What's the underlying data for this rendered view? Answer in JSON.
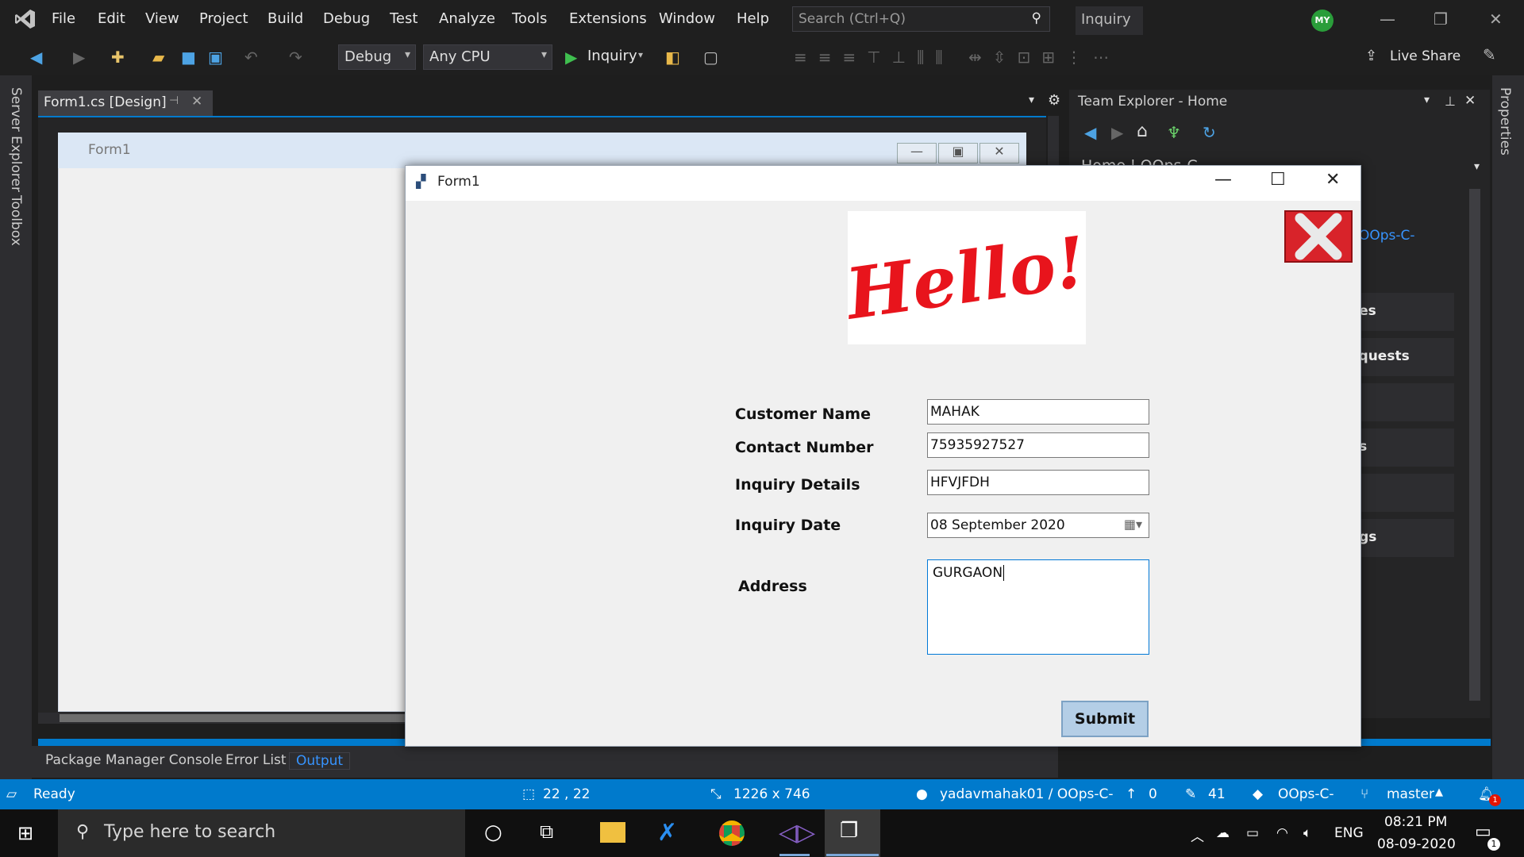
{
  "menu": [
    "File",
    "Edit",
    "View",
    "Project",
    "Build",
    "Debug",
    "Test",
    "Analyze",
    "Tools",
    "Extensions",
    "Window",
    "Help"
  ],
  "search_placeholder": "Search (Ctrl+Q)",
  "solution_name": "Inquiry",
  "avatar": "MY",
  "toolbar": {
    "config": "Debug",
    "platform": "Any CPU",
    "run_label": "Inquiry",
    "live_share": "Live Share"
  },
  "sidebar": {
    "server_explorer": "Server Explorer",
    "toolbox": "Toolbox",
    "properties": "Properties"
  },
  "doc_tab": "Form1.cs [Design]",
  "designer_form_title": "Form1",
  "team_explorer": {
    "title": "Team Explorer - Home",
    "home": "Home | OOps-C-",
    "repo_link": "OOps-C-",
    "items": [
      "hes",
      "equests",
      "ns",
      "ngs"
    ]
  },
  "bottom_tabs": [
    "Package Manager Console",
    "Error List",
    "Output"
  ],
  "status": {
    "ready": "Ready",
    "position": "22 , 22",
    "size": "1226 x 746",
    "repo": "yadavmahak01 / OOps-C-",
    "push": "0",
    "changes": "41",
    "project": "OOps-C-",
    "branch": "master",
    "notifications": "1"
  },
  "taskbar": {
    "search": "Type here to search",
    "lang": "ENG",
    "time": "08:21 PM",
    "date": "08-09-2020",
    "notif": "1"
  },
  "form": {
    "title": "Form1",
    "hello_text": "Hello!",
    "labels": {
      "customer_name": "Customer Name",
      "contact_number": "Contact Number",
      "inquiry_details": "Inquiry Details",
      "inquiry_date": "Inquiry Date",
      "address": "Address"
    },
    "values": {
      "customer_name": "MAHAK",
      "contact_number": "75935927527",
      "inquiry_details": "HFVJFDH",
      "inquiry_date": "08 September 2020",
      "address": "GURGAON"
    },
    "submit": "Submit"
  },
  "colors": {
    "accent": "#007acc",
    "vs_purple": "#865fc5",
    "hello_red": "#e8141c"
  }
}
